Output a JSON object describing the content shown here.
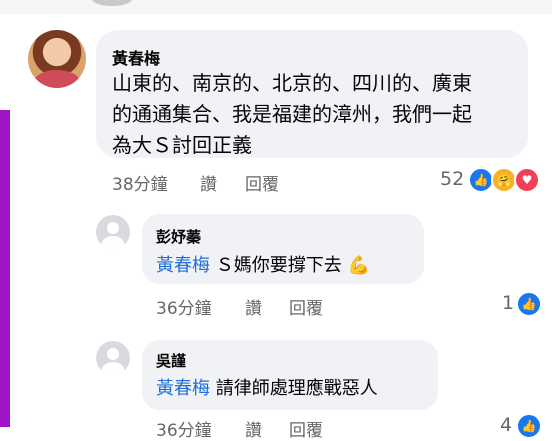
{
  "comments": [
    {
      "author": "黃春梅",
      "lines": [
        "山東的、南京的、北京的、四川的、廣東",
        "的通通集合、我是福建的漳州，我們一起",
        "為大Ｓ討回正義"
      ],
      "time": "38分鐘",
      "like_label": "讚",
      "reply_label": "回覆",
      "reaction_count": "52",
      "reactions": [
        "like-icon",
        "care-icon",
        "love-icon"
      ]
    },
    {
      "author": "彭妤蓁",
      "mention": "黃春梅",
      "text": "Ｓ媽你要撐下去",
      "emoji": "💪",
      "time": "36分鐘",
      "like_label": "讚",
      "reply_label": "回覆",
      "reaction_count": "1",
      "reactions": [
        "like-icon"
      ]
    },
    {
      "author": "吳謹",
      "mention": "黃春梅",
      "text": "請律師處理應戰惡人",
      "time": "36分鐘",
      "like_label": "讚",
      "reply_label": "回覆",
      "reaction_count": "4",
      "reactions": [
        "like-icon"
      ]
    }
  ],
  "colors": {
    "accent_bar": "#a014c8",
    "mention": "#216fdb",
    "bubble": "#f0f2f5",
    "meta": "#65676b"
  }
}
